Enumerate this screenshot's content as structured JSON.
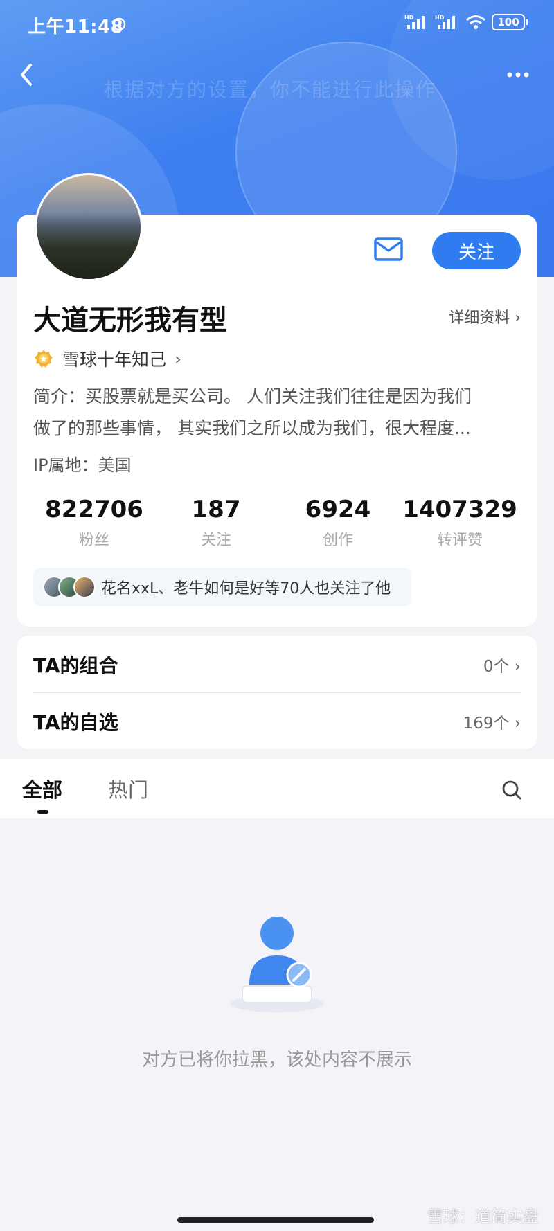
{
  "status_bar": {
    "time": "上午11:48",
    "battery": "100"
  },
  "header": {
    "overlay_text": "根据对方的设置，你不能进行此操作"
  },
  "profile": {
    "name": "大道无形我有型",
    "follow_label": "关注",
    "detail_label": "详细资料 ›",
    "badge_label": "雪球十年知己",
    "badge_chevron": "›",
    "bio_line1": "简介：买股票就是买公司。 人们关注我们往往是因为我们",
    "bio_line2": "做了的那些事情， 其实我们之所以成为我们，很大程度...",
    "ip_location": "IP属地：美国"
  },
  "stats": [
    {
      "value": "822706",
      "label": "粉丝"
    },
    {
      "value": "187",
      "label": "关注"
    },
    {
      "value": "6924",
      "label": "创作"
    },
    {
      "value": "1407329",
      "label": "转评赞"
    }
  ],
  "mutual_followers": "花名xxL、老牛如何是好等70人也关注了他",
  "portfolio": {
    "combos_label": "TA的组合",
    "combos_value": "0个 ›",
    "watchlist_label": "TA的自选",
    "watchlist_value": "169个 ›"
  },
  "tabs": {
    "all": "全部",
    "hot": "热门"
  },
  "blocked": {
    "message": "对方已将你拉黑，该处内容不展示"
  },
  "watermark": "雪球：道简实盘",
  "colors": {
    "accent": "#2f7cf0",
    "header": "#3d7ff0"
  },
  "icons": [
    "back-icon",
    "more-icon",
    "mail-icon",
    "search-icon",
    "alarm-icon",
    "wifi-icon",
    "signal-icon",
    "badge-icon"
  ]
}
